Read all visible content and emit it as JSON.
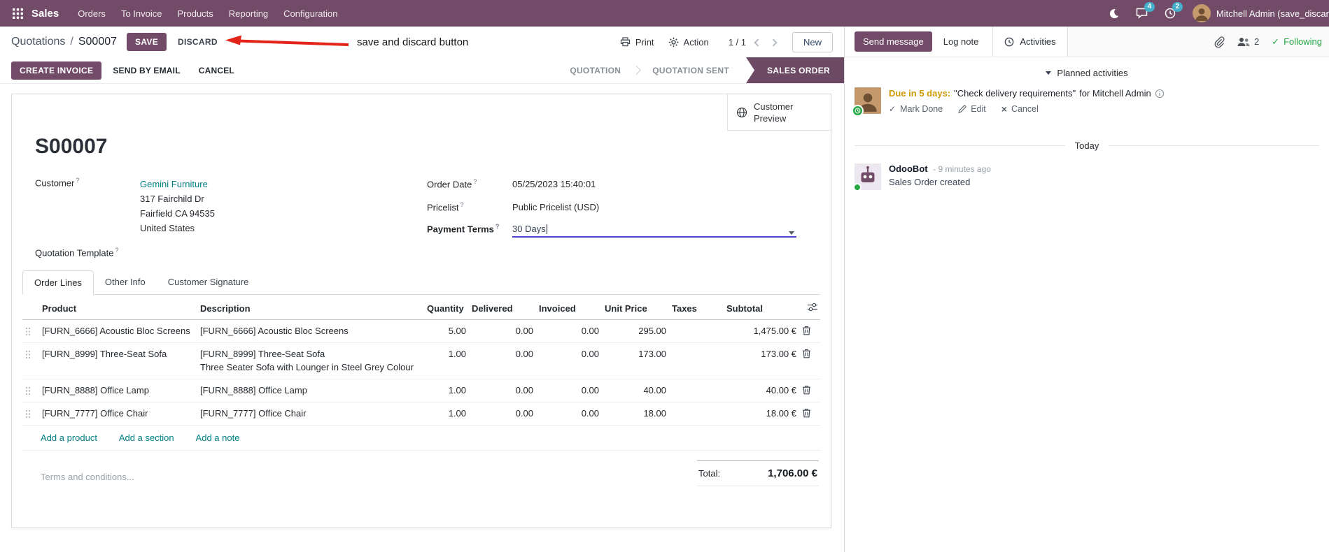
{
  "colors": {
    "brand": "#714B67",
    "link_teal": "#017E84",
    "edited_value_blue": "#2776D2",
    "status_active_bg": "#6D4A63",
    "due_warning": "#CC9A06",
    "following_green": "#28A745",
    "annotation_red": "#E3241B",
    "notification_badge": "#45AECB"
  },
  "navbar": {
    "app_name": "Sales",
    "menus": [
      "Orders",
      "To Invoice",
      "Products",
      "Reporting",
      "Configuration"
    ],
    "messages_badge": "4",
    "activities_badge": "2",
    "user_name": "Mitchell Admin (save_discar"
  },
  "control_panel": {
    "breadcrumb_parent": "Quotations",
    "breadcrumb_separator": "/",
    "breadcrumb_current": "S00007",
    "save_label": "SAVE",
    "discard_label": "DISCARD",
    "annotation_text": "save and discard button",
    "print_label": "Print",
    "action_label": "Action",
    "pager_value": "1 / 1",
    "new_label": "New"
  },
  "status_bar": {
    "create_invoice": "CREATE INVOICE",
    "send_by_email": "SEND BY EMAIL",
    "cancel": "CANCEL",
    "states": [
      {
        "label": "QUOTATION"
      },
      {
        "label": "QUOTATION SENT"
      },
      {
        "label": "SALES ORDER"
      }
    ]
  },
  "sheet": {
    "customer_preview": "Customer Preview",
    "title": "S00007",
    "help_marker": "?",
    "customer": {
      "label": "Customer",
      "name": "Gemini Furniture",
      "address": [
        "317 Fairchild Dr",
        "Fairfield CA 94535",
        "United States"
      ]
    },
    "quotation_template_label": "Quotation Template",
    "order_date": {
      "label": "Order Date",
      "value": "05/25/2023 15:40:01"
    },
    "pricelist": {
      "label": "Pricelist",
      "value": "Public Pricelist (USD)"
    },
    "payment_terms": {
      "label": "Payment Terms",
      "value": "30 Days"
    },
    "tabs": [
      {
        "label": "Order Lines"
      },
      {
        "label": "Other Info"
      },
      {
        "label": "Customer Signature"
      }
    ],
    "table": {
      "headers": {
        "product": "Product",
        "description": "Description",
        "quantity": "Quantity",
        "delivered": "Delivered",
        "invoiced": "Invoiced",
        "unit_price": "Unit Price",
        "taxes": "Taxes",
        "subtotal": "Subtotal"
      },
      "rows": [
        {
          "product": "[FURN_6666] Acoustic Bloc Screens",
          "description": "[FURN_6666] Acoustic Bloc Screens",
          "quantity": "5.00",
          "delivered": "0.00",
          "invoiced": "0.00",
          "unit_price": "295.00",
          "subtotal": "1,475.00 €"
        },
        {
          "product": "[FURN_8999] Three-Seat Sofa",
          "description": "[FURN_8999] Three-Seat Sofa",
          "description2": "Three Seater Sofa with Lounger in Steel Grey Colour",
          "quantity": "1.00",
          "delivered": "0.00",
          "invoiced": "0.00",
          "unit_price": "173.00",
          "subtotal": "173.00 €"
        },
        {
          "product": "[FURN_8888] Office Lamp",
          "description": "[FURN_8888] Office Lamp",
          "quantity": "1.00",
          "delivered": "0.00",
          "invoiced": "0.00",
          "unit_price": "40.00",
          "subtotal": "40.00 €"
        },
        {
          "product": "[FURN_7777] Office Chair",
          "description": "[FURN_7777] Office Chair",
          "quantity": "1.00",
          "delivered": "0.00",
          "invoiced": "0.00",
          "unit_price": "18.00",
          "subtotal": "18.00 €"
        }
      ]
    },
    "add_product": "Add a product",
    "add_section": "Add a section",
    "add_note": "Add a note",
    "terms_placeholder": "Terms and conditions...",
    "total_label": "Total:",
    "total_value": "1,706.00 €"
  },
  "chatter": {
    "send_message": "Send message",
    "log_note": "Log note",
    "activities_tab": "Activities",
    "followers_count": "2",
    "following": "Following",
    "planned_activities_header": "Planned activities",
    "activity": {
      "due": "Due in 5 days:",
      "summary": "\"Check delivery requirements\"",
      "assignee": "for Mitchell Admin",
      "mark_done": "Mark Done",
      "edit": "Edit",
      "cancel": "Cancel"
    },
    "date_divider": "Today",
    "message": {
      "author": "OdooBot",
      "time": "- 9 minutes ago",
      "body": "Sales Order created"
    }
  }
}
